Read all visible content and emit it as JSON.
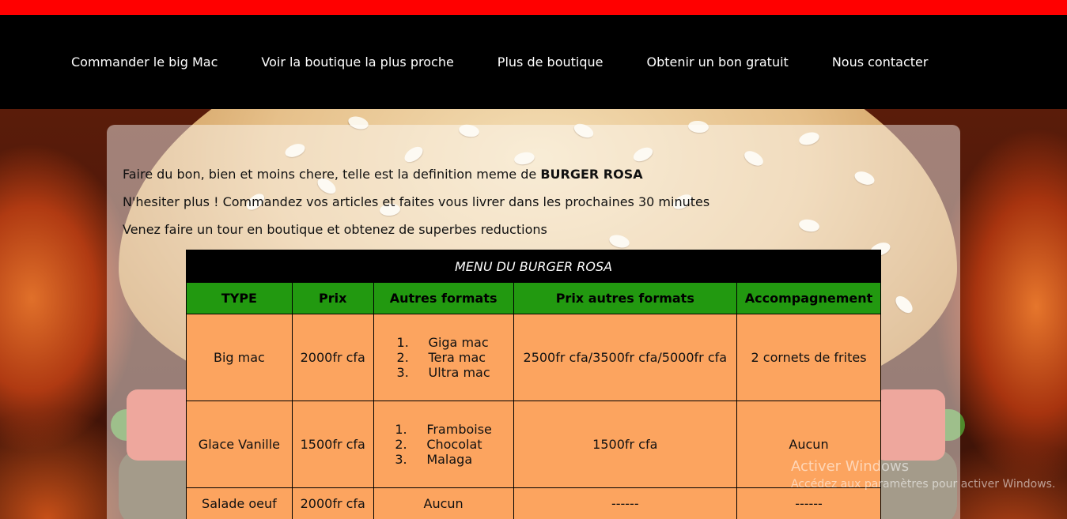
{
  "nav": {
    "items": [
      {
        "label": "Commander le big Mac"
      },
      {
        "label": "Voir la boutique la plus proche"
      },
      {
        "label": "Plus de boutique"
      },
      {
        "label": "Obtenir un bon gratuit"
      },
      {
        "label": "Nous contacter"
      }
    ]
  },
  "intro": {
    "line1_prefix": "Faire du bon, bien et moins chere, telle est la definition meme de ",
    "line1_brand": "BURGER ROSA",
    "line2": "N'hesiter plus ! Commandez vos articles et faites vous livrer dans les prochaines 30 minutes",
    "line3": "Venez faire un tour en boutique et obtenez de superbes reductions"
  },
  "menu": {
    "caption": "MENU DU BURGER ROSA",
    "headers": [
      "TYPE",
      "Prix",
      "Autres formats",
      "Prix autres formats",
      "Accompagnement"
    ],
    "rows": [
      {
        "type": "Big mac",
        "prix": "2000fr cfa",
        "formats": [
          "Giga mac",
          "Tera mac",
          "Ultra mac"
        ],
        "prix_formats": "2500fr cfa/3500fr cfa/5000fr cfa",
        "accompagnement": "2 cornets de frites"
      },
      {
        "type": "Glace Vanille",
        "prix": "1500fr cfa",
        "formats": [
          "Framboise",
          "Chocolat",
          "Malaga"
        ],
        "prix_formats": "1500fr cfa",
        "accompagnement": "Aucun"
      },
      {
        "type": "Salade oeuf",
        "prix": "2000fr cfa",
        "formats_text": "Aucun",
        "prix_formats": "------",
        "accompagnement": "------"
      }
    ]
  },
  "watermark": {
    "title": "Activer Windows",
    "subtitle": "Accédez aux paramètres pour activer Windows."
  }
}
